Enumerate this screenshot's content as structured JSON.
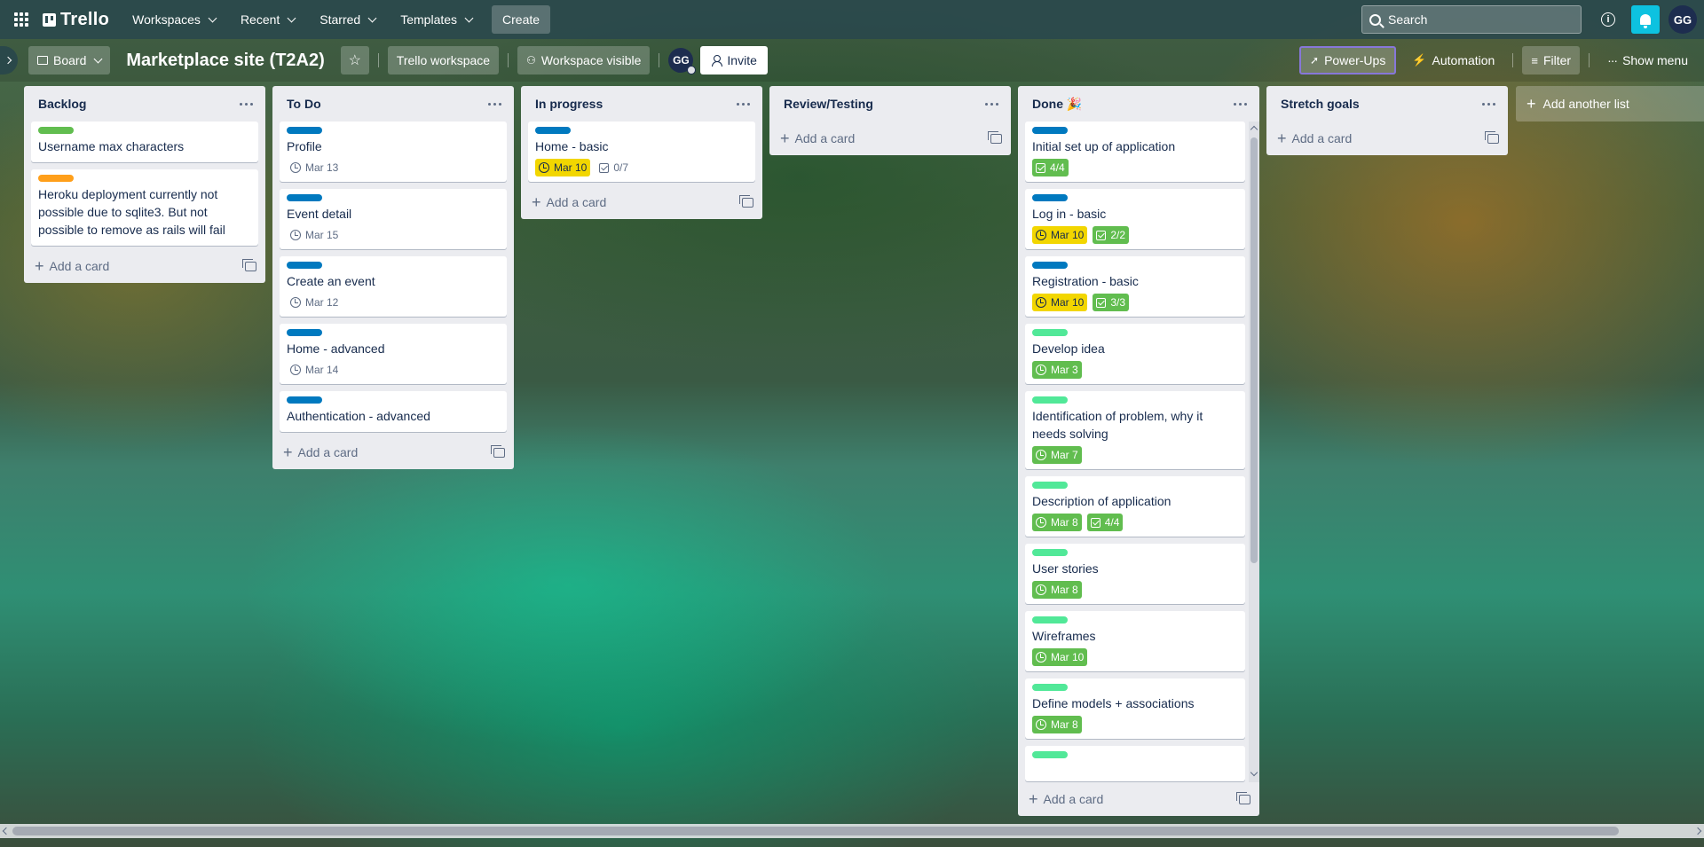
{
  "nav": {
    "logo": "Trello",
    "menus": [
      "Workspaces",
      "Recent",
      "Starred",
      "Templates"
    ],
    "create": "Create",
    "search_placeholder": "Search",
    "avatar": "GG"
  },
  "header": {
    "view": "Board",
    "title": "Marketplace site (T2A2)",
    "workspace": "Trello workspace",
    "visibility": "Workspace visible",
    "member": "GG",
    "invite": "Invite",
    "powerups": "Power-Ups",
    "automation": "Automation",
    "filter": "Filter",
    "show_menu": "Show menu"
  },
  "add_card_label": "Add a card",
  "add_list_label": "Add another list",
  "colors": {
    "label_green": "#61bd4f",
    "label_orange": "#ff9f1a",
    "label_blue": "#0079bf",
    "label_lime": "#51e898",
    "due_warning": "#f2d600",
    "complete": "#61bd4f"
  },
  "lists": [
    {
      "title": "Backlog",
      "cards": [
        {
          "label": "label_green",
          "title": "Username max characters"
        },
        {
          "label": "label_orange",
          "title": "Heroku deployment currently not possible due to sqlite3. But not possible to remove as rails will fail"
        }
      ]
    },
    {
      "title": "To Do",
      "cards": [
        {
          "label": "label_blue",
          "title": "Profile",
          "date": "Mar 13"
        },
        {
          "label": "label_blue",
          "title": "Event detail",
          "date": "Mar 15"
        },
        {
          "label": "label_blue",
          "title": "Create an event",
          "date": "Mar 12"
        },
        {
          "label": "label_blue",
          "title": "Home - advanced",
          "date": "Mar 14"
        },
        {
          "label": "label_blue",
          "title": "Authentication - advanced"
        }
      ]
    },
    {
      "title": "In progress",
      "cards": [
        {
          "label": "label_blue",
          "title": "Home - basic",
          "date": "Mar 10",
          "date_state": "warn",
          "checklist": "0/7"
        }
      ]
    },
    {
      "title": "Review/Testing",
      "cards": []
    },
    {
      "title": "Done 🎉",
      "cards": [
        {
          "label": "label_blue",
          "title": "Initial set up of application",
          "checklist": "4/4",
          "checklist_state": "done"
        },
        {
          "label": "label_blue",
          "title": "Log in - basic",
          "date": "Mar 10",
          "date_state": "warn",
          "checklist": "2/2",
          "checklist_state": "done"
        },
        {
          "label": "label_blue",
          "title": "Registration - basic",
          "date": "Mar 10",
          "date_state": "warn",
          "checklist": "3/3",
          "checklist_state": "done"
        },
        {
          "label": "label_lime",
          "title": "Develop idea",
          "date": "Mar 3",
          "date_state": "done"
        },
        {
          "label": "label_lime",
          "title": "Identification of problem, why it needs solving",
          "date": "Mar 7",
          "date_state": "done"
        },
        {
          "label": "label_lime",
          "title": "Description of application",
          "date": "Mar 8",
          "date_state": "done",
          "checklist": "4/4",
          "checklist_state": "done"
        },
        {
          "label": "label_lime",
          "title": "User stories",
          "date": "Mar 8",
          "date_state": "done"
        },
        {
          "label": "label_lime",
          "title": "Wireframes",
          "date": "Mar 10",
          "date_state": "done"
        },
        {
          "label": "label_lime",
          "title": "Define models + associations",
          "date": "Mar 8",
          "date_state": "done"
        }
      ]
    },
    {
      "title": "Stretch goals",
      "cards": []
    }
  ]
}
